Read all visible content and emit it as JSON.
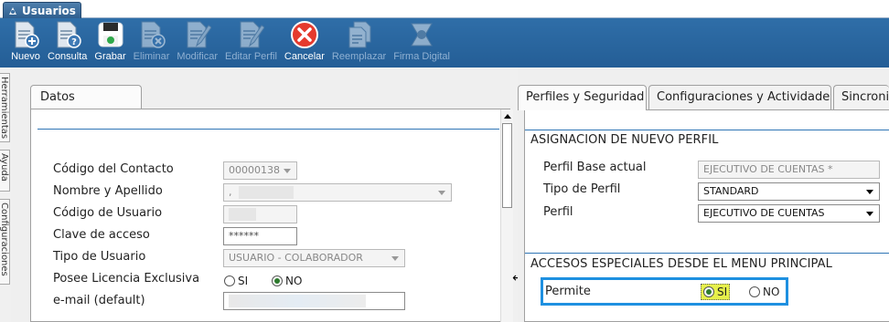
{
  "window_tab": {
    "title": "Usuarios"
  },
  "toolbar": {
    "buttons": [
      {
        "label": "Nuevo",
        "icon": "new-document-icon",
        "enabled": true
      },
      {
        "label": "Consulta",
        "icon": "query-document-icon",
        "enabled": true
      },
      {
        "label": "Grabar",
        "icon": "save-disk-icon",
        "enabled": true
      },
      {
        "label": "Eliminar",
        "icon": "delete-document-icon",
        "enabled": false
      },
      {
        "label": "Modificar",
        "icon": "edit-document-icon",
        "enabled": false
      },
      {
        "label": "Editar Perfil",
        "icon": "edit-profile-icon",
        "enabled": false
      },
      {
        "label": "Cancelar",
        "icon": "cancel-icon",
        "enabled": true
      },
      {
        "label": "Reemplazar",
        "icon": "replace-documents-icon",
        "enabled": false
      },
      {
        "label": "Firma Digital",
        "icon": "digital-signature-icon",
        "enabled": false
      }
    ]
  },
  "side_tabs": [
    "Herramientas",
    "Ayuda",
    "Configuraciones"
  ],
  "left": {
    "tab": "Datos Principales",
    "fields": {
      "codigo_contacto": {
        "label": "Código del Contacto",
        "value": "00000138"
      },
      "nombre": {
        "label": "Nombre y Apellido",
        "value": ","
      },
      "codigo_usuario": {
        "label": "Código de Usuario",
        "value": ""
      },
      "clave": {
        "label": "Clave de acceso",
        "value": "******"
      },
      "tipo_usuario": {
        "label": "Tipo de Usuario",
        "value": "USUARIO - COLABORADOR"
      },
      "licencia": {
        "label": "Posee Licencia Exclusiva",
        "options": [
          "SI",
          "NO"
        ],
        "selected": "NO"
      },
      "email": {
        "label": "e-mail (default)",
        "value": ""
      }
    }
  },
  "right": {
    "tabs": [
      "Perfiles y Seguridad",
      "Configuraciones y Actividades",
      "Sincroniz"
    ],
    "active_tab": "Perfiles y Seguridad",
    "section1": {
      "title": "ASIGNACION DE NUEVO PERFIL",
      "perfil_base": {
        "label": "Perfil Base actual",
        "value": "EJECUTIVO DE CUENTAS *"
      },
      "tipo_perfil": {
        "label": "Tipo de Perfil",
        "value": "STANDARD"
      },
      "perfil": {
        "label": "Perfil",
        "value": "EJECUTIVO DE CUENTAS"
      }
    },
    "section2": {
      "title": "ACCESOS ESPECIALES DESDE EL MENU PRINCIPAL",
      "permite": {
        "label": "Permite",
        "options": [
          "SI",
          "NO"
        ],
        "selected": "SI"
      }
    }
  },
  "colors": {
    "toolbar": "#2a66a0",
    "accent_rule": "#2f75b5",
    "highlight_border": "#1e90e0",
    "cancel_red": "#e53a2e",
    "selected_yellow": "#e6f04a"
  }
}
